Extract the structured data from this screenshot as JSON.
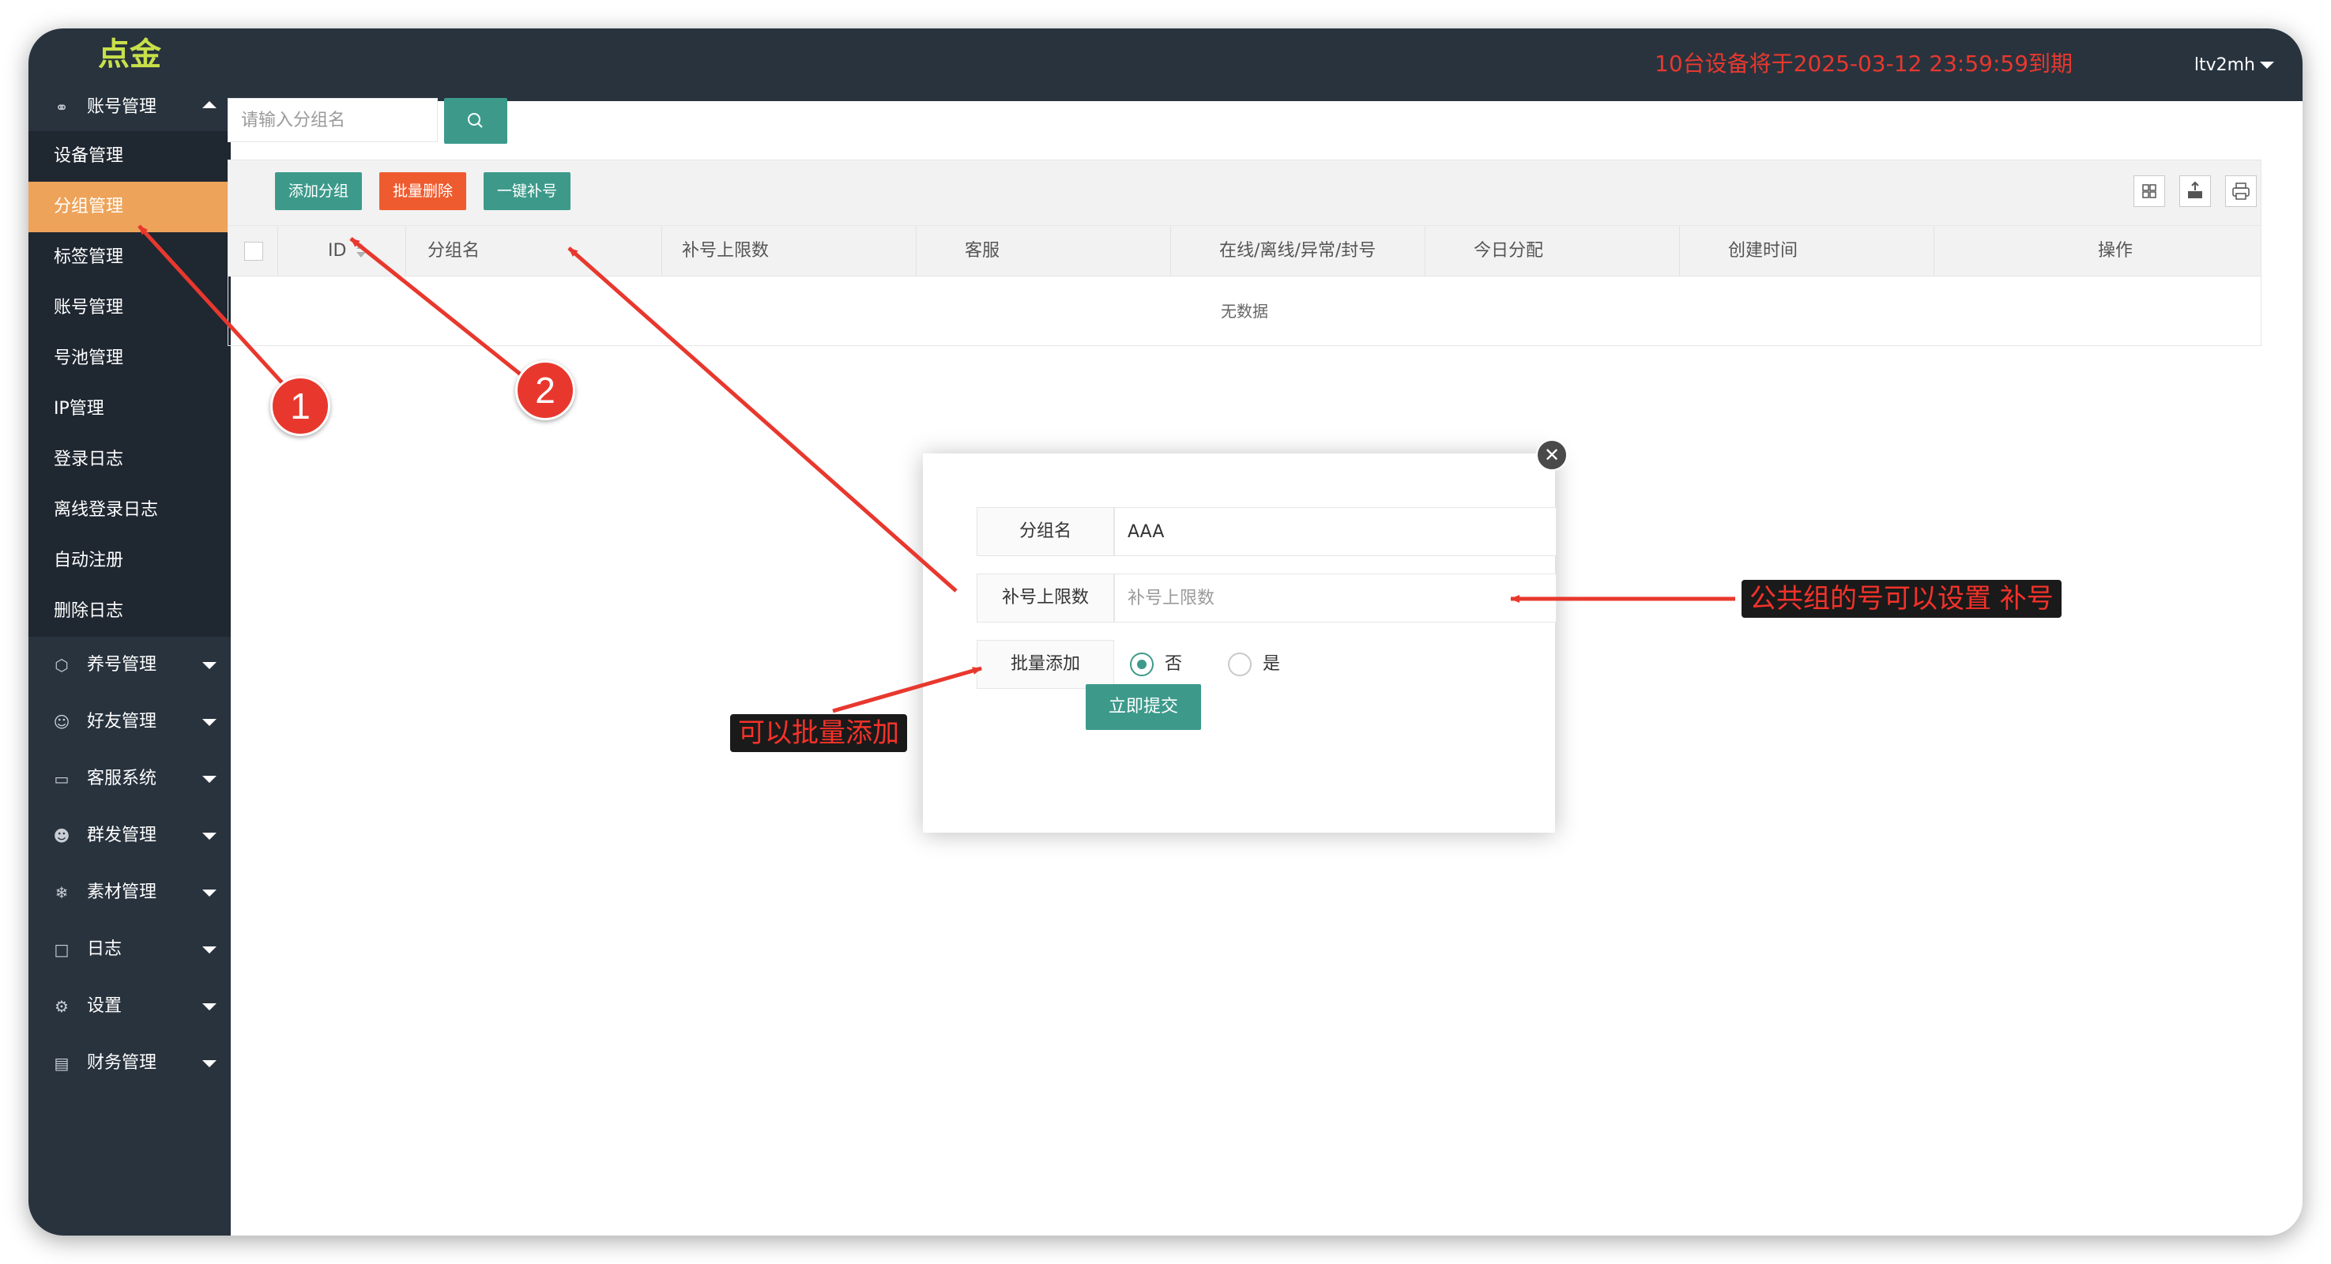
{
  "sidebar": {
    "logo": "点金",
    "account_menu": {
      "label": "账号管理",
      "icon": "account-icon"
    },
    "sub_items": [
      "设备管理",
      "分组管理",
      "标签管理",
      "账号管理",
      "号池管理",
      "IP管理",
      "登录日志",
      "离线登录日志",
      "自动注册",
      "删除日志"
    ],
    "active_sub": "分组管理",
    "menus": [
      {
        "label": "养号管理",
        "icon": "cube-icon"
      },
      {
        "label": "好友管理",
        "icon": "user-icon"
      },
      {
        "label": "客服系统",
        "icon": "window-icon"
      },
      {
        "label": "群发管理",
        "icon": "users-icon"
      },
      {
        "label": "素材管理",
        "icon": "snowflake-icon"
      },
      {
        "label": "日志",
        "icon": "file-icon"
      },
      {
        "label": "设置",
        "icon": "gear-icon"
      },
      {
        "label": "财务管理",
        "icon": "money-icon"
      }
    ]
  },
  "header": {
    "notice": "10台设备将于2025-03-12 23:59:59到期",
    "user": "ltv2mh"
  },
  "search": {
    "placeholder": "请输入分组名",
    "button_icon": "search-icon"
  },
  "toolbar": {
    "add_group": "添加分组",
    "batch_delete": "批量删除",
    "one_click_refill": "一键补号",
    "right_icons": [
      "columns-icon",
      "export-icon",
      "print-icon"
    ]
  },
  "table": {
    "columns": [
      "ID",
      "分组名",
      "补号上限数",
      "客服",
      "在线/离线/异常/封号",
      "今日分配",
      "创建时间",
      "操作"
    ],
    "empty_text": "无数据"
  },
  "modal": {
    "group_name_label": "分组名",
    "group_name_value": "AAA",
    "refill_limit_label": "补号上限数",
    "refill_limit_placeholder": "补号上限数",
    "batch_add_label": "批量添加",
    "option_no": "否",
    "option_yes": "是",
    "selected_option": "否",
    "submit": "立即提交"
  },
  "annotations": {
    "callout_batch": "可以批量添加",
    "callout_refill": "公共组的号可以设置 补号",
    "badge_1": "1",
    "badge_2": "2"
  },
  "colors": {
    "sidebar": "#28333e",
    "submenu": "#1f2731",
    "active_item": "#eda35a",
    "primary": "#3d9a8b",
    "danger": "#ee5b2f",
    "notice": "#e8382e",
    "logo": "#c8e04a",
    "annotation": "#e8382e"
  }
}
